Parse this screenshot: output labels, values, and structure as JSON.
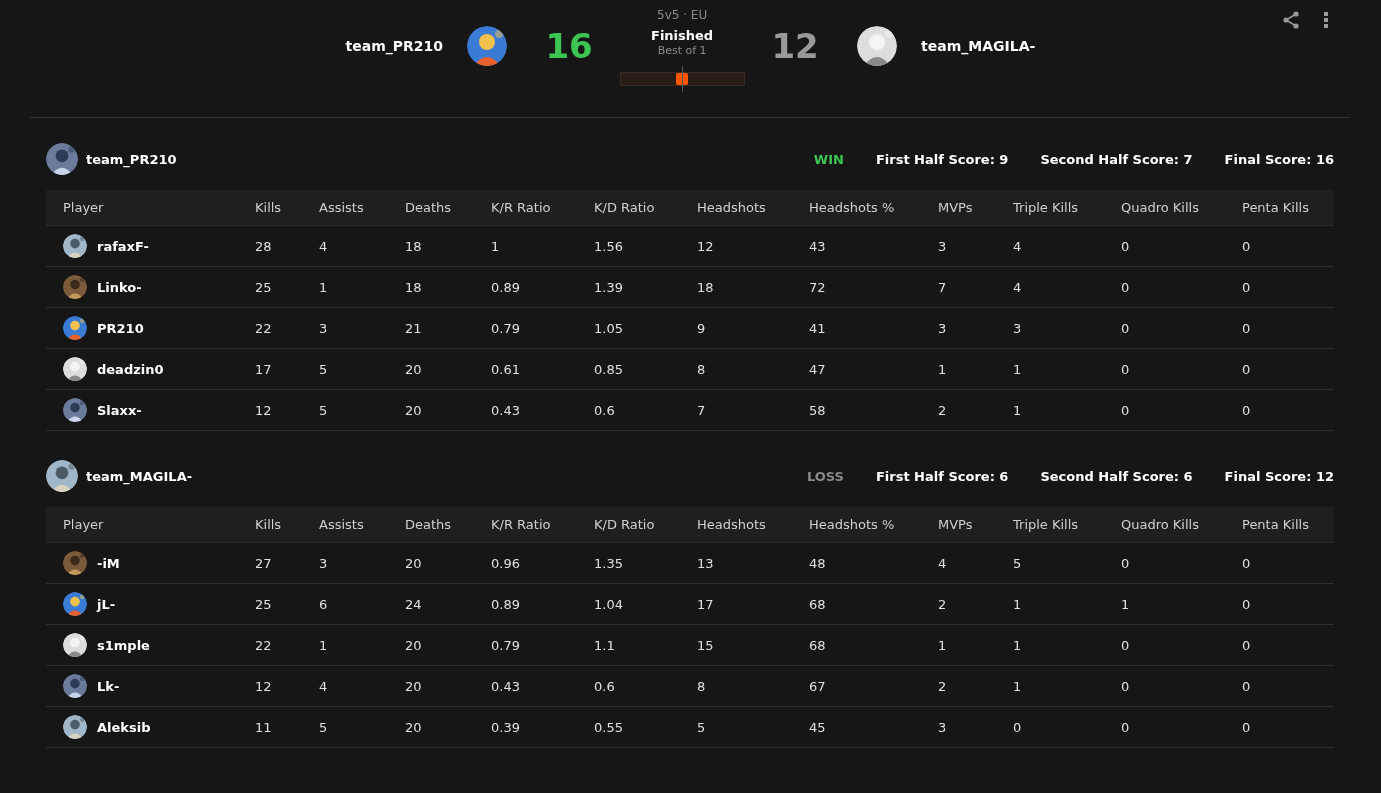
{
  "match": {
    "mode": "5v5 · EU",
    "status": "Finished",
    "format": "Best of 1",
    "home": {
      "name": "team_PR210",
      "score": "16",
      "winner": true
    },
    "away": {
      "name": "team_MAGILA-",
      "score": "12",
      "winner": false
    },
    "timeline": {
      "level": 0.5
    }
  },
  "teams": [
    {
      "name": "team_PR210",
      "result": "WIN",
      "won": true,
      "scores": [
        "First Half Score: 9",
        "Second Half Score: 7",
        "Final Score: 16"
      ],
      "columns": [
        "Player",
        "Kills",
        "Assists",
        "Deaths",
        "K/R Ratio",
        "K/D Ratio",
        "Headshots",
        "Headshots %",
        "MVPs",
        "Triple Kills",
        "Quadro Kills",
        "Penta Kills"
      ],
      "rows": [
        {
          "cells": [
            "rafaxF-",
            "28",
            "4",
            "18",
            "1",
            "1.56",
            "12",
            "43",
            "3",
            "4",
            "0",
            "0"
          ]
        },
        {
          "cells": [
            "Linko-",
            "25",
            "1",
            "18",
            "0.89",
            "1.39",
            "18",
            "72",
            "7",
            "4",
            "0",
            "0"
          ]
        },
        {
          "cells": [
            "PR210",
            "22",
            "3",
            "21",
            "0.79",
            "1.05",
            "9",
            "41",
            "3",
            "3",
            "0",
            "0"
          ]
        },
        {
          "cells": [
            "deadzin0",
            "17",
            "5",
            "20",
            "0.61",
            "0.85",
            "8",
            "47",
            "1",
            "1",
            "0",
            "0"
          ]
        },
        {
          "cells": [
            "Slaxx-",
            "12",
            "5",
            "20",
            "0.43",
            "0.6",
            "7",
            "58",
            "2",
            "1",
            "0",
            "0"
          ]
        }
      ]
    },
    {
      "name": "team_MAGILA-",
      "result": "LOSS",
      "won": false,
      "scores": [
        "First Half Score: 6",
        "Second Half Score: 6",
        "Final Score: 12"
      ],
      "columns": [
        "Player",
        "Kills",
        "Assists",
        "Deaths",
        "K/R Ratio",
        "K/D Ratio",
        "Headshots",
        "Headshots %",
        "MVPs",
        "Triple Kills",
        "Quadro Kills",
        "Penta Kills"
      ],
      "rows": [
        {
          "cells": [
            "-iM",
            "27",
            "3",
            "20",
            "0.96",
            "1.35",
            "13",
            "48",
            "4",
            "5",
            "0",
            "0"
          ]
        },
        {
          "cells": [
            "jL-",
            "25",
            "6",
            "24",
            "0.89",
            "1.04",
            "17",
            "68",
            "2",
            "1",
            "1",
            "0"
          ]
        },
        {
          "cells": [
            "s1mple",
            "22",
            "1",
            "20",
            "0.79",
            "1.1",
            "15",
            "68",
            "1",
            "1",
            "0",
            "0"
          ]
        },
        {
          "cells": [
            "Lk-",
            "12",
            "4",
            "20",
            "0.43",
            "0.6",
            "8",
            "67",
            "2",
            "1",
            "0",
            "0"
          ]
        },
        {
          "cells": [
            "Aleksib",
            "11",
            "5",
            "20",
            "0.39",
            "0.55",
            "5",
            "45",
            "3",
            "0",
            "0",
            "0"
          ]
        }
      ]
    }
  ]
}
